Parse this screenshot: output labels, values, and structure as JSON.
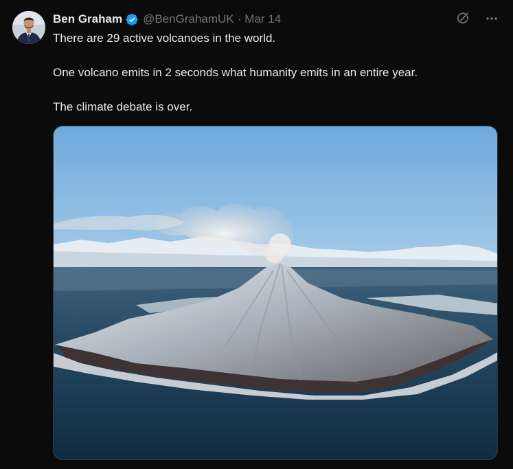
{
  "author": {
    "name": "Ben Graham",
    "handle": "@BenGrahamUK",
    "separator": "·",
    "date": "Mar 14",
    "verified": true,
    "verified_color": "#1d9bf0"
  },
  "tweet": {
    "lines": [
      "There are 29 active volcanoes in the world.",
      "One volcano emits in 2 seconds what humanity emits in an entire year.",
      "The climate debate is over."
    ]
  },
  "icons": {
    "grok": "grok-icon",
    "more": "more-options-icon",
    "verified": "verified-badge-icon"
  },
  "media": {
    "subject": "volcano-photo"
  },
  "colors": {
    "background": "#0b0b0c",
    "text": "#e7e9ea",
    "muted": "#71767b"
  }
}
